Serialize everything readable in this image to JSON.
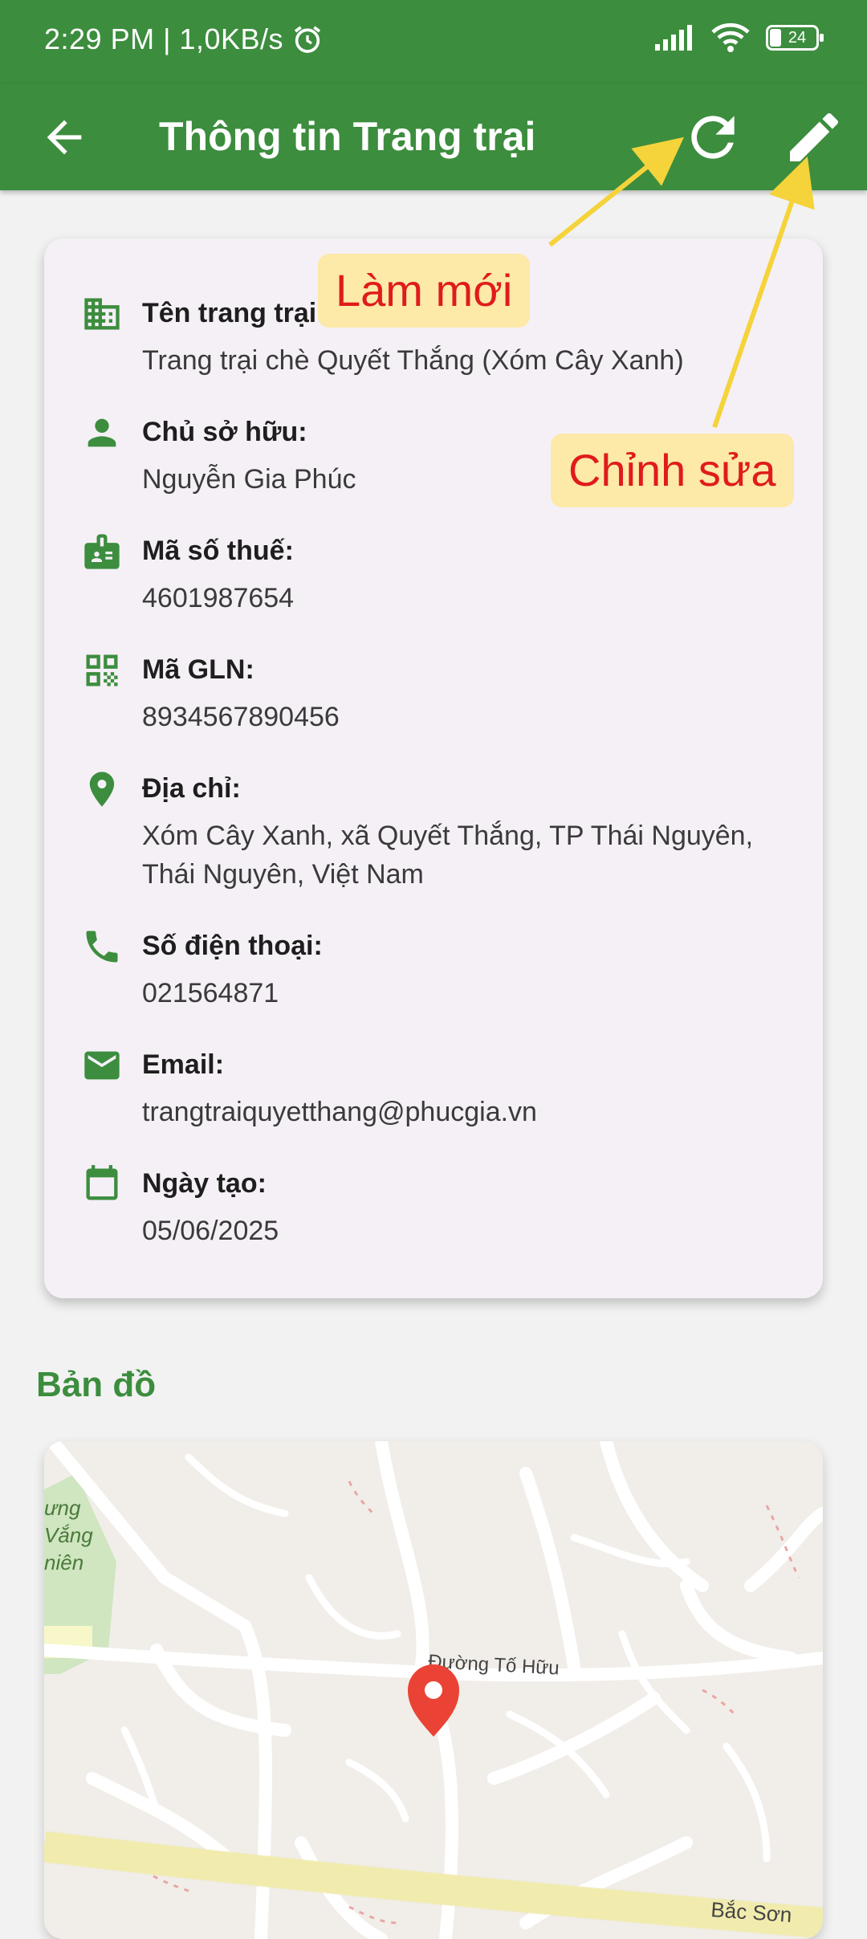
{
  "status_bar": {
    "time_speed": "2:29 PM | 1,0KB/s",
    "battery": "24"
  },
  "app_bar": {
    "title": "Thông tin Trang trại",
    "icons": [
      "back-arrow-icon",
      "refresh-icon",
      "edit-icon"
    ]
  },
  "farm_info": {
    "rows": [
      {
        "icon": "building-icon",
        "label": "Tên trang trại:",
        "value": "Trang trại chè Quyết Thắng (Xóm Cây Xanh)"
      },
      {
        "icon": "person-icon",
        "label": "Chủ sở hữu:",
        "value": "Nguyễn Gia Phúc"
      },
      {
        "icon": "id-badge-icon",
        "label": "Mã số thuế:",
        "value": "4601987654"
      },
      {
        "icon": "qr-code-icon",
        "label": "Mã GLN:",
        "value": "8934567890456"
      },
      {
        "icon": "location-pin-icon",
        "label": "Địa chỉ:",
        "value": "Xóm Cây Xanh, xã Quyết Thắng, TP Thái Nguyên, Thái Nguyên, Việt Nam"
      },
      {
        "icon": "phone-icon",
        "label": "Số điện thoại:",
        "value": "021564871"
      },
      {
        "icon": "email-icon",
        "label": "Email:",
        "value": "trangtraiquyetthang@phucgia.vn"
      },
      {
        "icon": "calendar-icon",
        "label": "Ngày tạo:",
        "value": "05/06/2025"
      }
    ]
  },
  "map_section": {
    "title": "Bản đồ",
    "road_label_1": "Đường Tố Hữu",
    "road_label_2": "Bắc Sơn",
    "park_label_1": "ưng",
    "park_label_2": "Vắng",
    "park_label_3": "niên"
  },
  "annotations": {
    "refresh": "Làm mới",
    "edit": "Chỉnh sửa"
  },
  "colors": {
    "primary": "#3c8d3e",
    "card": "#f5f0f6",
    "annotation_bg": "#fde9a8",
    "annotation_text": "#e01b1b",
    "arrow": "#f5d33a",
    "map_pin": "#ea4335"
  }
}
